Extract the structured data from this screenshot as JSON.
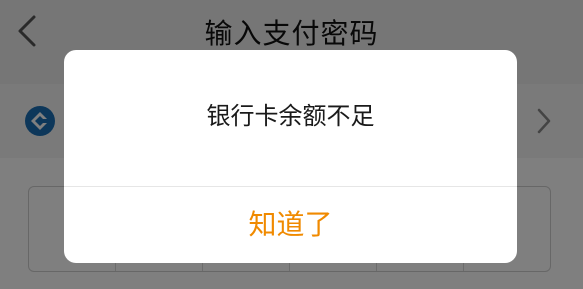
{
  "header": {
    "title": "输入支付密码"
  },
  "dialog": {
    "message": "银行卡余额不足",
    "confirm_label": "知道了"
  },
  "icons": {
    "back": "chevron-left-icon",
    "bank": "bank-logo-icon",
    "chevron": "chevron-right-icon"
  },
  "colors": {
    "accent": "#f08a00",
    "bank_logo": "#1a6fb5"
  }
}
